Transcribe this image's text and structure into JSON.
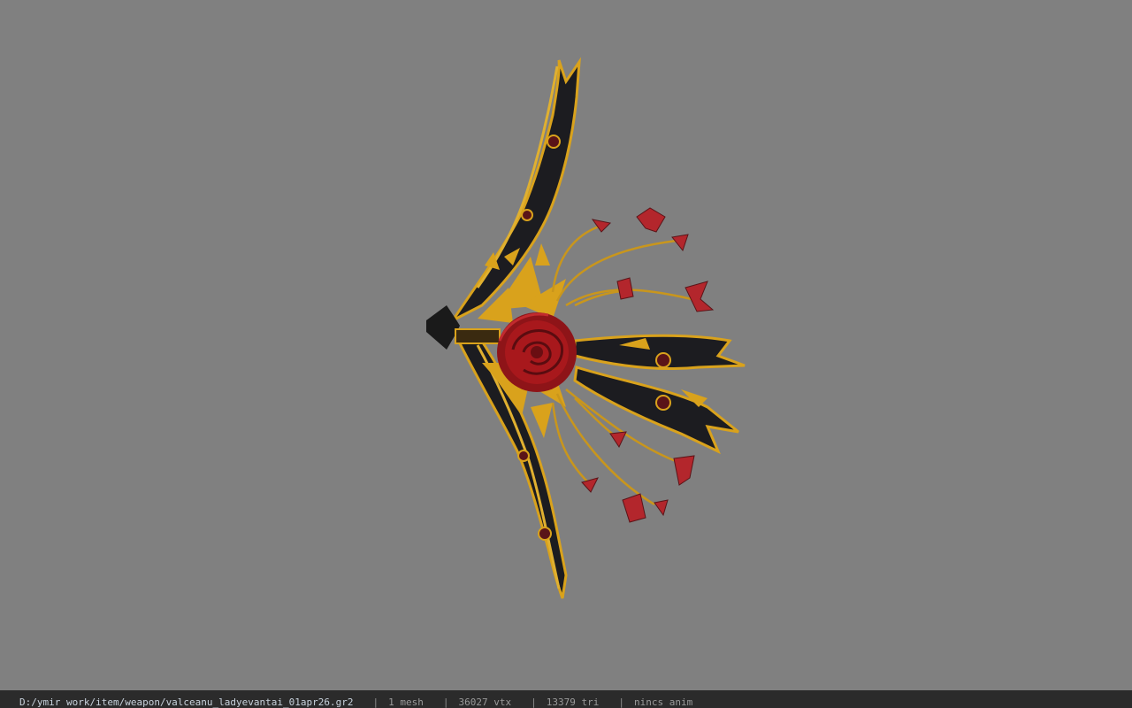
{
  "status_bar": {
    "file_path": "D:/ymir work/item/weapon/valceanu_ladyevantai_01apr26.gr2",
    "separator": "|",
    "mesh_count": "1 mesh",
    "vertex_count": "36027 vtx",
    "triangle_count": "13379 tri",
    "anim_status": "nincs anim"
  },
  "model": {
    "icon": "ornate-rose-bow-model",
    "colors": {
      "background": "#808080",
      "dark_body": "#1c1c20",
      "gold": "#d9a21c",
      "rose_red": "#a8181c",
      "leaf_red": "#b3262c"
    }
  }
}
